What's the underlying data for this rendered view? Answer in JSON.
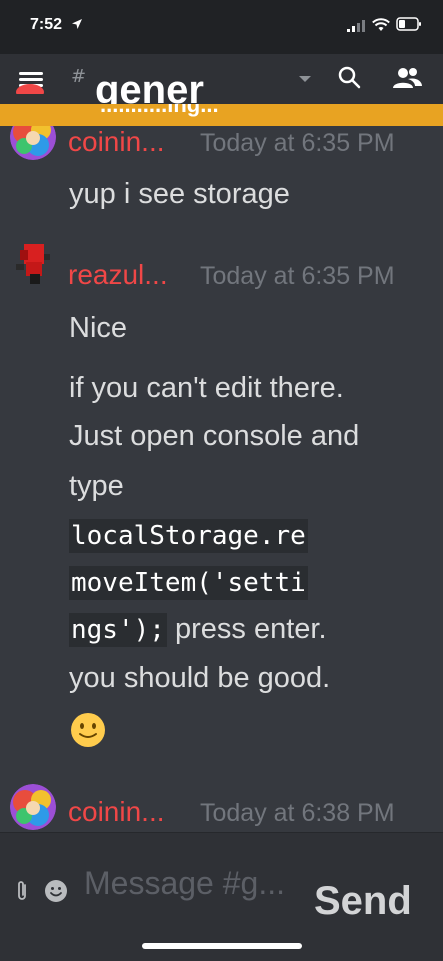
{
  "status_bar": {
    "time": "7:52"
  },
  "header": {
    "hash": "#",
    "channel_name": "gener",
    "banner_text": "...........ing..."
  },
  "messages": [
    {
      "author": "coinin...",
      "timestamp": "Today at 6:35 PM",
      "lines": [
        "yup i see storage"
      ],
      "avatar_icon": "colorful-avatar"
    },
    {
      "author": "reazul...",
      "timestamp": "Today at 6:35 PM",
      "lines": [
        "Nice",
        "if you can't edit there.",
        "Just open console and",
        "type"
      ],
      "code_lines": [
        "localStorage.re",
        "moveItem('setti",
        "ngs');"
      ],
      "after_code": " press enter.",
      "final_line": "you should be good.",
      "emoji": "slightly-smiling-face",
      "avatar_icon": "red-fist-avatar"
    },
    {
      "author": "coinin...",
      "timestamp": "Today at 6:38 PM",
      "avatar_icon": "colorful-avatar"
    }
  ],
  "composer": {
    "placeholder": "Message #g...",
    "send_label": "Send"
  },
  "colors": {
    "author_name": "#f04747",
    "banner": "#e8a322",
    "background": "#36393f"
  }
}
